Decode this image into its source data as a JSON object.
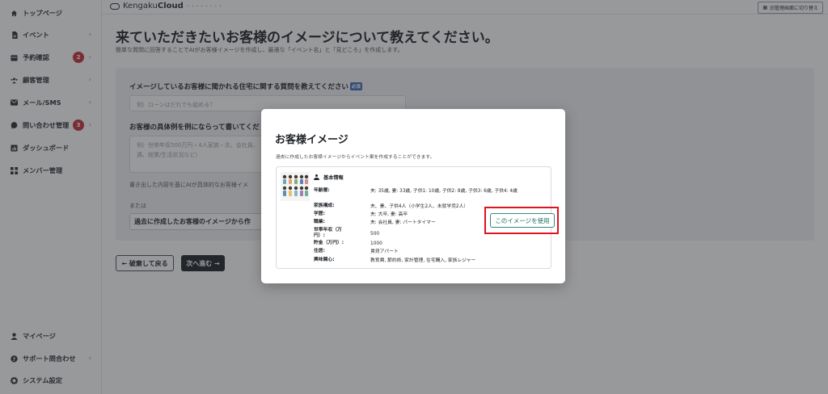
{
  "sidebar": {
    "items": [
      {
        "label": "トップページ",
        "icon": "home-icon"
      },
      {
        "label": "イベント",
        "icon": "document-icon"
      },
      {
        "label": "予約確認",
        "icon": "calendar-icon",
        "badge": "2"
      },
      {
        "label": "顧客管理",
        "icon": "users-icon"
      },
      {
        "label": "メール/SMS",
        "icon": "mail-icon"
      },
      {
        "label": "問い合わせ管理",
        "icon": "chat-icon",
        "badge": "3"
      },
      {
        "label": "ダッシュボード",
        "icon": "chart-icon"
      },
      {
        "label": "メンバー管理",
        "icon": "grid-icon"
      }
    ],
    "bottom": [
      {
        "label": "マイページ",
        "icon": "person-icon"
      },
      {
        "label": "サポート問合わせ",
        "icon": "help-icon"
      },
      {
        "label": "システム設定",
        "icon": "gear-icon"
      }
    ]
  },
  "header": {
    "logo_light": "Kengaku",
    "logo_bold": "Cloud",
    "logo_sub": "• • • • • • • •",
    "switch_label": "旧管理画面に切り替え"
  },
  "main": {
    "title": "来ていただきたいお客様のイメージについて教えてください。",
    "description": "簡単な質問に回答することでAIがお客様イメージを作成し、最適な「イベント名」と「見どころ」を作成します。",
    "q1_label": "イメージしているお客様に聞かれる住宅に関する質問を教えてください",
    "q1_required": "必須",
    "q1_placeholder": "例）ローンはだれでも組める？",
    "q2_label": "お客様の具体例を例にならって書いてくだ",
    "q2_placeholder": "例）世帯年収500万円・4人家族・夫、会社員、\n遇、総業/生活状況など）",
    "hint": "書き出した内容を基にAIが具体的なお客様イメ",
    "or": "または",
    "past_button": "過去に作成したお客様のイメージから作",
    "back_button": "← 破棄して戻る",
    "next_button": "次へ進む →"
  },
  "modal": {
    "title": "お客様イメージ",
    "description": "過去に作成したお客様イメージからイベント案を作成することができます。",
    "section_title": "基本情報",
    "fields": [
      {
        "key": "年齢層:",
        "value": "夫: 35歳, 妻: 33歳, 子供1: 10歳, 子供2: 8歳, 子供3: 6歳, 子供4: 4歳"
      },
      {
        "key": "家族構成:",
        "value": "夫、妻、子供4人（小学生2人、未就学児2人）"
      },
      {
        "key": "学歴:",
        "value": "夫: 大卒, 妻: 高卒"
      },
      {
        "key": "職業:",
        "value": "夫: 会社員, 妻: パートタイマー"
      },
      {
        "key": "世帯年収（万円）:",
        "value": "500"
      },
      {
        "key": "貯金（万円）:",
        "value": "1000"
      },
      {
        "key": "住居:",
        "value": "賃貸アパート"
      },
      {
        "key": "興味関心:",
        "value": "教育費, 節約術, 家計管理, 住宅購入, 家族レジャー"
      }
    ],
    "use_button": "このイメージを使用"
  },
  "colors": {
    "badge": "#c7313d",
    "required_tag": "#3c6bb5",
    "use_button_border": "#2f8a7e",
    "highlight": "#e0141e"
  }
}
